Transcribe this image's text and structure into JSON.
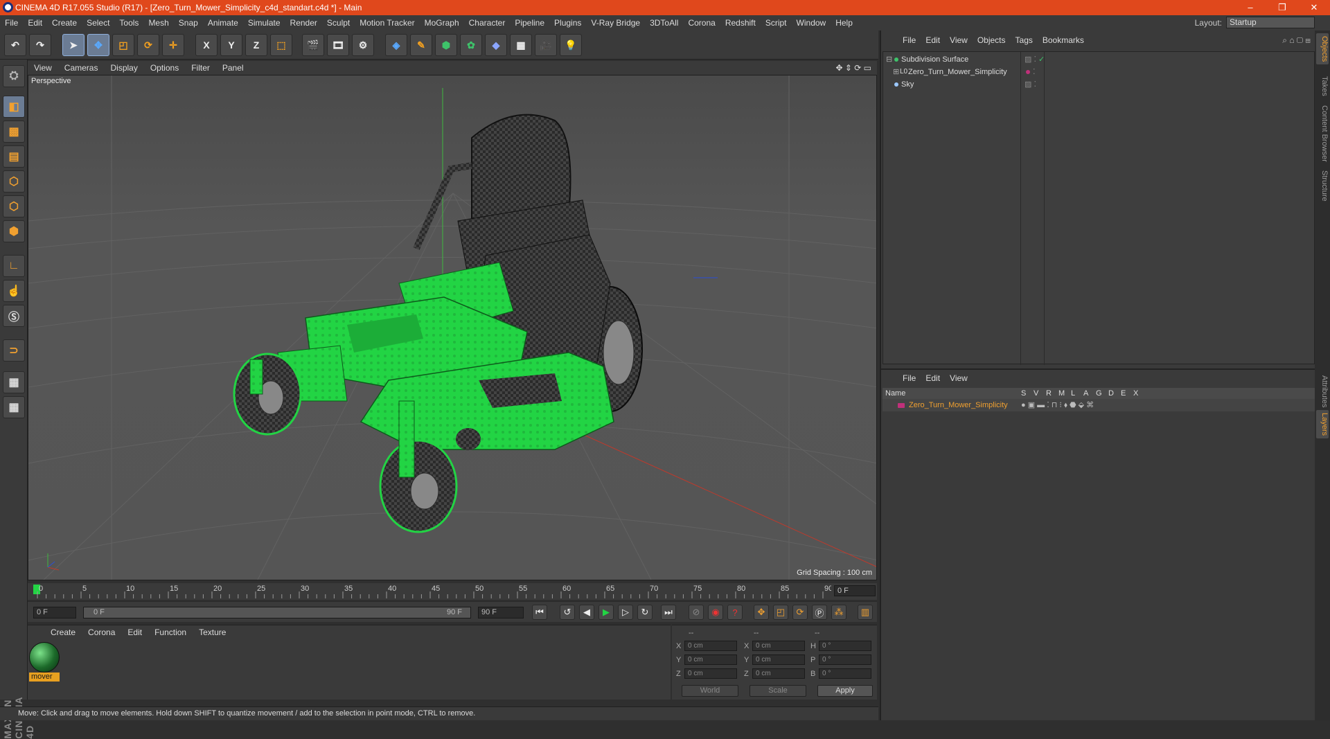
{
  "window": {
    "title": "CINEMA 4D R17.055 Studio (R17) - [Zero_Turn_Mower_Simplicity_c4d_standart.c4d *] - Main"
  },
  "menu": [
    "File",
    "Edit",
    "Create",
    "Select",
    "Tools",
    "Mesh",
    "Snap",
    "Animate",
    "Simulate",
    "Render",
    "Sculpt",
    "Motion Tracker",
    "MoGraph",
    "Character",
    "Pipeline",
    "Plugins",
    "V-Ray Bridge",
    "3DToAll",
    "Corona",
    "Redshift",
    "Script",
    "Window",
    "Help"
  ],
  "layout": {
    "label": "Layout:",
    "value": "Startup"
  },
  "toolbar": {
    "x": "X",
    "y": "Y",
    "z": "Z"
  },
  "viewport": {
    "menu": [
      "View",
      "Cameras",
      "Display",
      "Options",
      "Filter",
      "Panel"
    ],
    "label": "Perspective",
    "grid_spacing": "Grid Spacing : 100 cm"
  },
  "timeline": {
    "ticks": [
      "0",
      "5",
      "10",
      "15",
      "20",
      "25",
      "30",
      "35",
      "40",
      "45",
      "50",
      "55",
      "60",
      "65",
      "70",
      "75",
      "80",
      "85",
      "90"
    ],
    "current_frame": "0 F"
  },
  "transport": {
    "start": "0 F",
    "range_start": "0 F",
    "range_end": "90 F",
    "end": "90 F"
  },
  "materials": {
    "menu": [
      "Create",
      "Corona",
      "Edit",
      "Function",
      "Texture"
    ],
    "items": [
      {
        "name": "mover"
      }
    ]
  },
  "coordinates": {
    "headers": [
      "--",
      "--",
      "--"
    ],
    "rows": [
      {
        "a": "X",
        "av": "0 cm",
        "b": "X",
        "bv": "0 cm",
        "c": "H",
        "cv": "0 °"
      },
      {
        "a": "Y",
        "av": "0 cm",
        "b": "Y",
        "bv": "0 cm",
        "c": "P",
        "cv": "0 °"
      },
      {
        "a": "Z",
        "av": "0 cm",
        "b": "Z",
        "bv": "0 cm",
        "c": "B",
        "cv": "0 °"
      }
    ],
    "mode1": "World",
    "mode2": "Scale",
    "apply": "Apply"
  },
  "status": "Move: Click and drag to move elements. Hold down SHIFT to quantize movement / add to the selection in point mode, CTRL to remove.",
  "objects_panel": {
    "menu": [
      "File",
      "Edit",
      "View",
      "Objects",
      "Tags",
      "Bookmarks"
    ],
    "items": [
      {
        "name": "Subdivision Surface"
      },
      {
        "name": "Zero_Turn_Mower_Simplicity"
      },
      {
        "name": "Sky"
      }
    ]
  },
  "layers_panel": {
    "menu": [
      "File",
      "Edit",
      "View"
    ],
    "columns": {
      "name": "Name",
      "flags": [
        "S",
        "V",
        "R",
        "M",
        "L",
        "A",
        "G",
        "D",
        "E",
        "X"
      ]
    },
    "rows": [
      {
        "name": "Zero_Turn_Mower_Simplicity",
        "color": "#c0307a"
      }
    ]
  },
  "side_tabs": [
    "Objects",
    "Takes",
    "Content Browser",
    "Structure",
    "Attributes",
    "Layers"
  ],
  "maxon": "MAXON CINEMA 4D",
  "colors": {
    "title_bar": "#e0481c",
    "accent": "#f0a030",
    "mower_green": "#22d444"
  }
}
